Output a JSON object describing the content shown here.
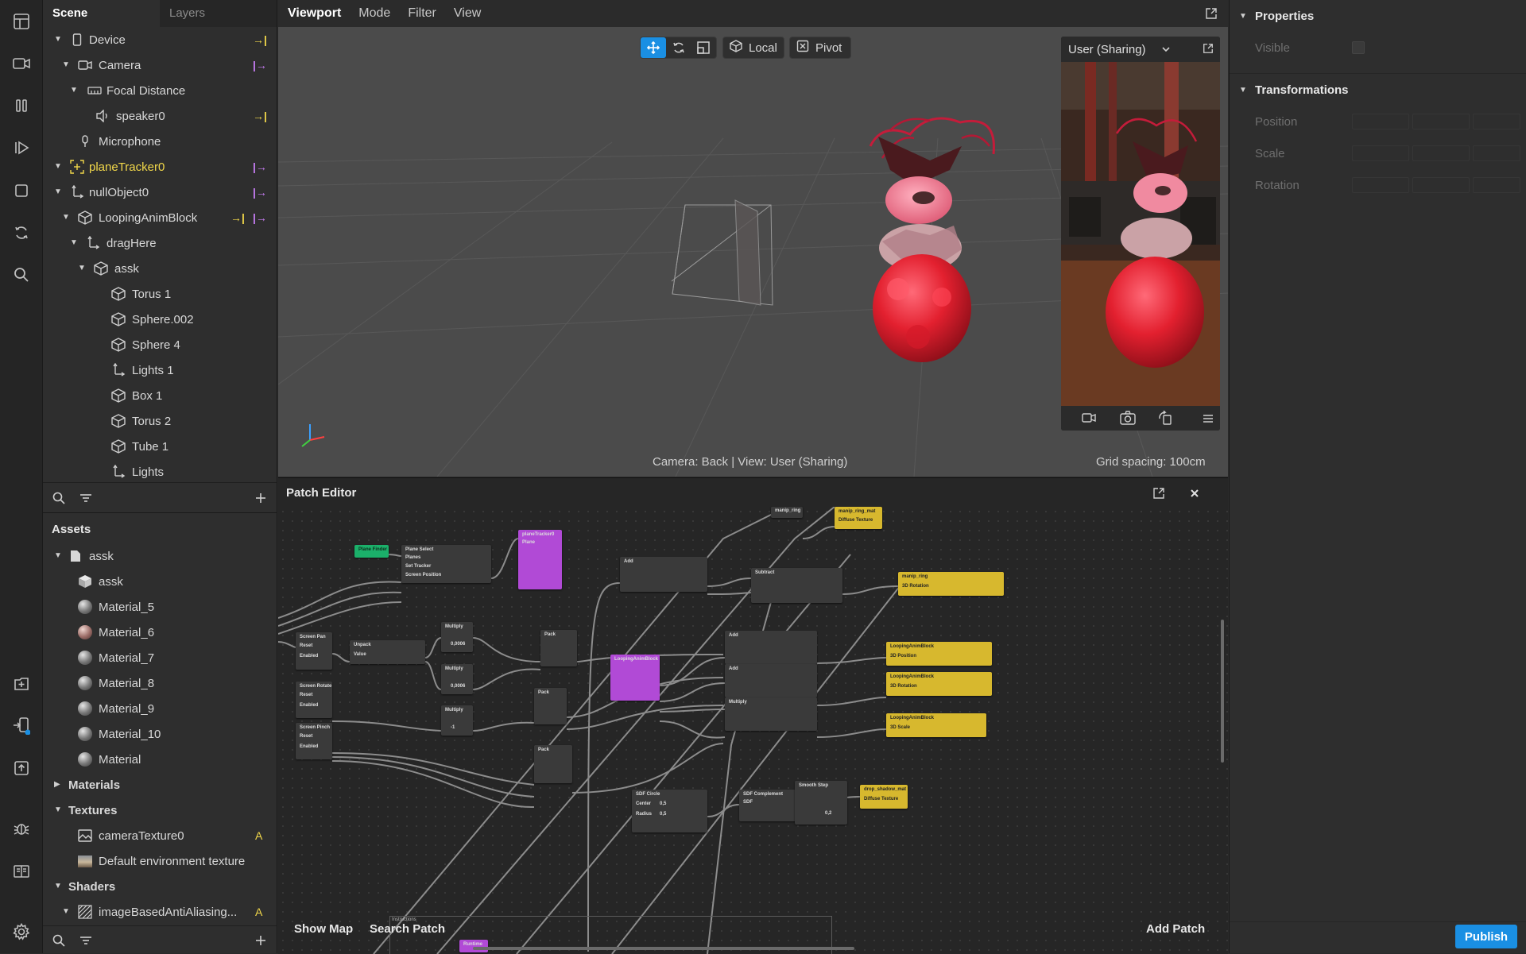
{
  "scene_panel": {
    "tabs": [
      "Scene",
      "Layers"
    ],
    "items": [
      {
        "label": "Device"
      },
      {
        "label": "Camera"
      },
      {
        "label": "Focal Distance"
      },
      {
        "label": "speaker0"
      },
      {
        "label": "Microphone"
      },
      {
        "label": "planeTracker0"
      },
      {
        "label": "nullObject0"
      },
      {
        "label": "LoopingAnimBlock"
      },
      {
        "label": "dragHere"
      },
      {
        "label": "assk"
      },
      {
        "label": "Torus 1"
      },
      {
        "label": "Sphere.002"
      },
      {
        "label": "Sphere 4"
      },
      {
        "label": "Lights 1"
      },
      {
        "label": "Box 1"
      },
      {
        "label": "Torus 2"
      },
      {
        "label": "Tube 1"
      },
      {
        "label": "Lights"
      }
    ]
  },
  "assets_panel": {
    "title": "Assets",
    "items": [
      {
        "label": "assk"
      },
      {
        "label": "assk"
      },
      {
        "label": "Material_5"
      },
      {
        "label": "Material_6"
      },
      {
        "label": "Material_7"
      },
      {
        "label": "Material_8"
      },
      {
        "label": "Material_9"
      },
      {
        "label": "Material_10"
      },
      {
        "label": "Material"
      },
      {
        "label": "Materials"
      },
      {
        "label": "Textures"
      },
      {
        "label": "cameraTexture0",
        "badge": "A"
      },
      {
        "label": "Default environment texture"
      },
      {
        "label": "Shaders"
      },
      {
        "label": "imageBasedAntiAliasing...",
        "badge": "A"
      }
    ]
  },
  "viewport": {
    "menu": [
      "Viewport",
      "Mode",
      "Filter",
      "View"
    ],
    "toolbar": {
      "local_label": "Local",
      "pivot_label": "Pivot"
    },
    "preview_selector": "User (Sharing)",
    "status_left": "Camera: Back | View: User (Sharing)",
    "status_right": "Grid spacing: 100cm"
  },
  "patch_editor": {
    "title": "Patch Editor",
    "footer": {
      "show_map": "Show Map",
      "search_patch": "Search Patch",
      "add_patch": "Add Patch"
    },
    "nodes": {
      "plane_finder": "Plane Finder",
      "plane_select": "Plane Select",
      "plane_select_planes": "Planes",
      "plane_select_set_tracker": "Set Tracker",
      "plane_select_screen_pos": "Screen Position",
      "plane_tracker": "planeTracker0",
      "plane_tracker_port": "Plane",
      "add1": "Add",
      "subtract": "Subtract",
      "manip_ring_small": "manip_ring",
      "manip_ring_mat": "manip_ring_mat",
      "diffuse_texture": "Diffuse Texture",
      "manip_ring": "manip_ring",
      "rotation_3d": "3D Rotation",
      "screen_pan": "Screen Pan",
      "reset": "Reset",
      "enabled": "Enabled",
      "unpack": "Unpack",
      "value": "Value",
      "multiply1": "Multiply",
      "multiply1_val": "0,0006",
      "multiply2": "Multiply",
      "multiply2_val": "0,0006",
      "multiply3": "Multiply",
      "multiply3_val": "-1",
      "pack1": "Pack",
      "pack2": "Pack",
      "pack3": "Pack",
      "looping_block": "LoopingAnimBlock",
      "add2": "Add",
      "add3": "Add",
      "multiply4": "Multiply",
      "lab_position": "LoopingAnimBlock",
      "position_3d": "3D Position",
      "lab_rotation": "LoopingAnimBlock",
      "lab_scale": "LoopingAnimBlock",
      "scale_3d": "3D Scale",
      "screen_rotate": "Screen Rotate",
      "screen_pinch": "Screen Pinch",
      "sdf_circle": "SDF Circle",
      "center": "Center",
      "radius": "Radius",
      "center_val": "0,5",
      "radius_val": "0,5",
      "sdf_complement": "SDF Complement",
      "sdf": "SDF",
      "smooth_step": "Smooth Step",
      "smooth_val": "0,2",
      "drop_shadow_mat": "drop_shadow_mat",
      "instructions": "Instructions",
      "runtime": "Runtime"
    }
  },
  "properties_panel": {
    "title": "Properties",
    "visible_label": "Visible",
    "transformations_title": "Transformations",
    "position_label": "Position",
    "scale_label": "Scale",
    "rotation_label": "Rotation",
    "publish_label": "Publish"
  },
  "colors": {
    "accent_blue": "#1a8fe3",
    "yellow": "#f2d84a",
    "purple": "#c77df5"
  }
}
